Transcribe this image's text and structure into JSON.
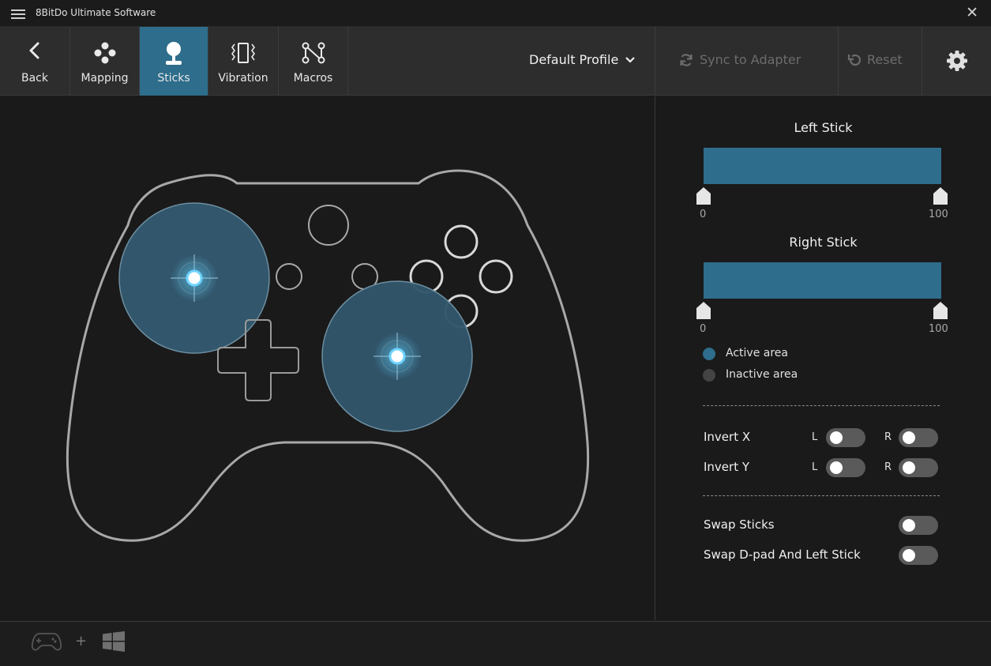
{
  "app": {
    "title": "8BitDo Ultimate Software"
  },
  "tabs": [
    {
      "label": "Back",
      "icon": "back-arrow-icon"
    },
    {
      "label": "Mapping",
      "icon": "buttons-cluster-icon"
    },
    {
      "label": "Sticks",
      "icon": "joystick-icon",
      "active": true
    },
    {
      "label": "Vibration",
      "icon": "vibration-icon"
    },
    {
      "label": "Macros",
      "icon": "macro-nodes-icon"
    }
  ],
  "toolbar": {
    "profile_label": "Default Profile",
    "sync_label": "Sync to Adapter",
    "reset_label": "Reset"
  },
  "panel": {
    "left_stick": {
      "title": "Left Stick",
      "min_label": "0",
      "max_label": "100",
      "range": [
        0,
        100
      ]
    },
    "right_stick": {
      "title": "Right Stick",
      "min_label": "0",
      "max_label": "100",
      "range": [
        0,
        100
      ]
    },
    "legend": {
      "active": "Active area",
      "inactive": "Inactive area"
    },
    "invert_x": {
      "label": "Invert X",
      "l": "L",
      "r": "R",
      "l_on": false,
      "r_on": false
    },
    "invert_y": {
      "label": "Invert Y",
      "l": "L",
      "r": "R",
      "l_on": false,
      "r_on": false
    },
    "swap_sticks": {
      "label": "Swap Sticks",
      "on": false
    },
    "swap_dpad": {
      "label": "Swap D-pad And Left Stick",
      "on": false
    }
  },
  "footer": {
    "plus": "+",
    "controller_icon": "controller-icon",
    "platform_icon": "windows-icon"
  },
  "colors": {
    "accent": "#2e6d8b",
    "active_area": "#2e6d8b",
    "inactive_area": "#444444",
    "glow": "#7fdcff"
  }
}
